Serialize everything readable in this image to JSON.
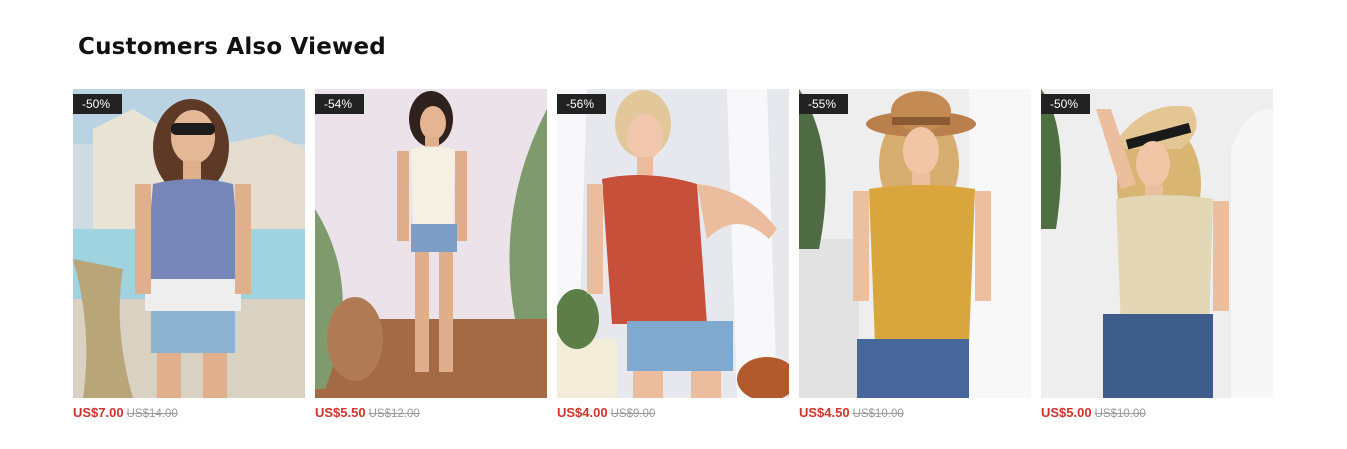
{
  "section": {
    "title": "Customers Also Viewed"
  },
  "products": [
    {
      "discount": "-50%",
      "price": "US$7.00",
      "original_price": "US$14.00",
      "image": "blue-white-striped-knit-tank-top"
    },
    {
      "discount": "-54%",
      "price": "US$5.50",
      "original_price": "US$12.00",
      "image": "white-button-knit-cami"
    },
    {
      "discount": "-56%",
      "price": "US$4.00",
      "original_price": "US$9.00",
      "image": "red-distressed-knit-tank"
    },
    {
      "discount": "-55%",
      "price": "US$4.50",
      "original_price": "US$10.00",
      "image": "mustard-pointelle-knit-tank"
    },
    {
      "discount": "-50%",
      "price": "US$5.00",
      "original_price": "US$10.00",
      "image": "beige-eyelet-knit-tank"
    }
  ],
  "colors": {
    "sale_price": "#d0332e",
    "original_price": "#999999",
    "badge_bg": "#222222"
  }
}
